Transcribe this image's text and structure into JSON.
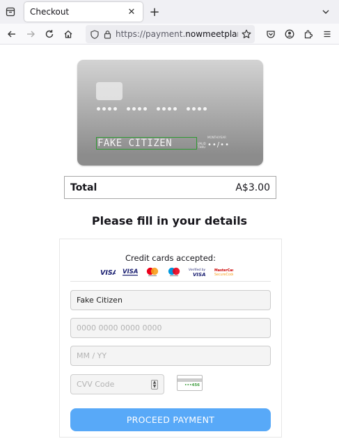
{
  "browser": {
    "tab_title": "Checkout",
    "tab_close_icon": "close-icon",
    "new_tab_glyph": "+",
    "url_prefix": "https://payment.",
    "url_domain": "nowmeetplan.c"
  },
  "card_preview": {
    "number_groups": [
      "••••",
      "••••",
      "••••",
      "••••"
    ],
    "name": "FAKE CITIZEN",
    "valid_label": "VALID THRU",
    "month_year_label": "MONTH/YEAR",
    "expiry": "••/••"
  },
  "total": {
    "label": "Total",
    "amount": "A$3.00"
  },
  "form": {
    "heading": "Please fill in your details",
    "accepted_label": "Credit cards accepted:",
    "logos": [
      "visa-logo",
      "visa-electron-logo",
      "mastercard-logo",
      "maestro-logo",
      "verified-by-visa-logo",
      "mastercard-securecode-logo"
    ],
    "name_value": "Fake Citizen",
    "card_number_placeholder": "0000 0000 0000 0000",
    "expiry_placeholder": "MM / YY",
    "cvv_placeholder": "CVV Code",
    "cvv_example": "•••456",
    "submit_label": "PROCEED PAYMENT"
  },
  "colors": {
    "accent": "#58a9f8",
    "name_outline": "#2d9a31"
  }
}
